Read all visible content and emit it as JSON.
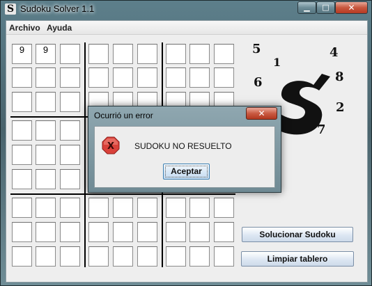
{
  "window": {
    "title": "Sudoku Solver 1.1",
    "icon": "S",
    "controls": {
      "minimize": "▁",
      "maximize": "□",
      "close": "✕"
    }
  },
  "menu": {
    "items": [
      "Archivo",
      "Ayuda"
    ]
  },
  "grid": {
    "rows": [
      [
        "9",
        "9",
        "",
        "",
        "",
        "",
        "",
        "",
        ""
      ],
      [
        "",
        "",
        "",
        "",
        "",
        "",
        "",
        "",
        ""
      ],
      [
        "",
        "",
        "",
        "",
        "",
        "",
        "",
        "",
        ""
      ],
      [
        "",
        "",
        "",
        "",
        "",
        "",
        "",
        "",
        ""
      ],
      [
        "",
        "",
        "",
        "",
        "",
        "",
        "",
        "",
        ""
      ],
      [
        "",
        "",
        "",
        "",
        "",
        "",
        "",
        "",
        ""
      ],
      [
        "",
        "",
        "",
        "",
        "",
        "",
        "",
        "",
        ""
      ],
      [
        "",
        "",
        "",
        "",
        "",
        "",
        "",
        "",
        ""
      ],
      [
        "",
        "",
        "",
        "",
        "",
        "",
        "",
        "",
        ""
      ]
    ]
  },
  "logo": {
    "letter": "S",
    "numbers": [
      "5",
      "1",
      "4",
      "6",
      "8",
      "2",
      "7"
    ]
  },
  "actions": {
    "solve_label": "Solucionar Sudoku",
    "clear_label": "Limpiar tablero"
  },
  "dialog": {
    "title": "Ocurrió un error",
    "message": "SUDOKU NO RESUELTO",
    "ok_label": "Aceptar",
    "close_glyph": "✕",
    "icon": "X"
  },
  "colors": {
    "error_icon": "#d9413a",
    "button_border": "#7a8ea6",
    "dialog_focus": "#3c7fb1"
  }
}
